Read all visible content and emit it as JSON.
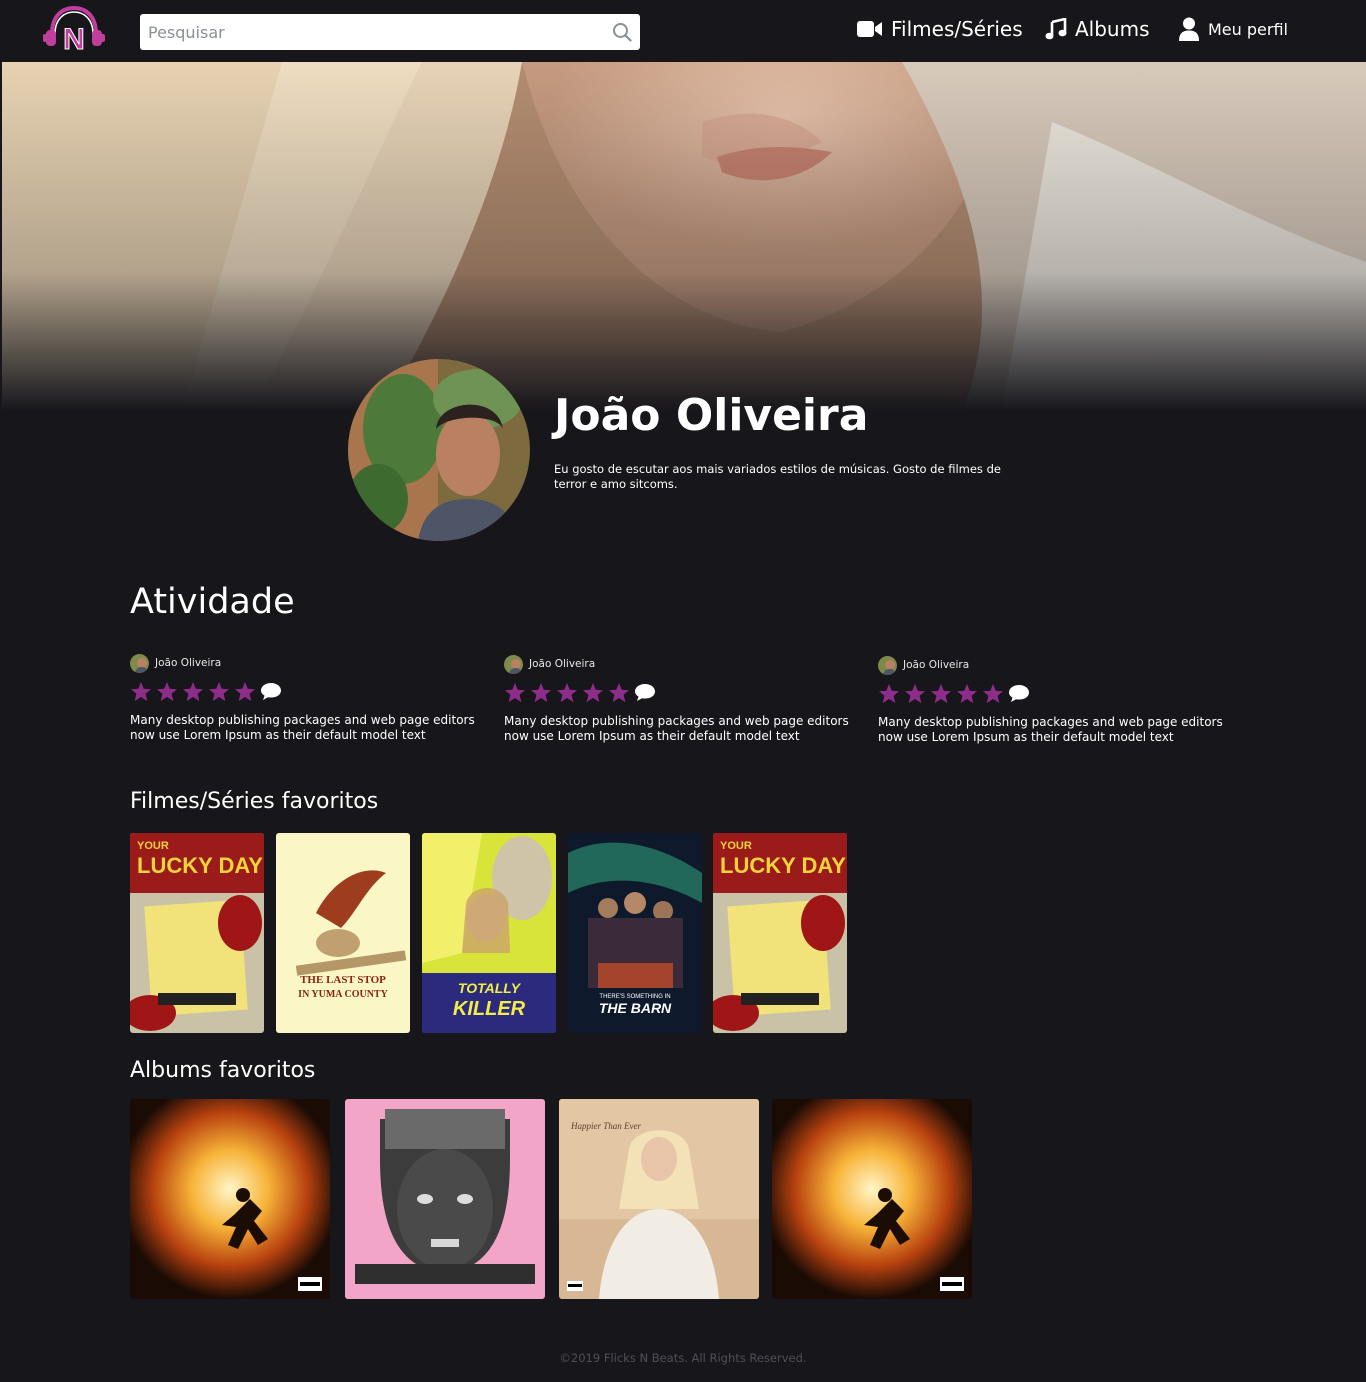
{
  "header": {
    "search_placeholder": "Pesquisar",
    "nav": {
      "films": "Filmes/Séries",
      "albums": "Albums",
      "profile": "Meu perfil"
    },
    "logo_letter": "N"
  },
  "profile": {
    "name": "João Oliveira",
    "bio": "Eu gosto de escutar aos mais variados estilos de músicas. Gosto de filmes de terror e amo sitcoms."
  },
  "activity": {
    "title": "Atividade",
    "items": [
      {
        "user": "João Oliveira",
        "stars": 5,
        "text": "Many desktop publishing packages and web page editors now use Lorem Ipsum as their default model text"
      },
      {
        "user": "João Oliveira",
        "stars": 5,
        "text": "Many desktop publishing packages and web page editors now use Lorem Ipsum as their default model text"
      },
      {
        "user": "João Oliveira",
        "stars": 5,
        "text": "Many desktop publishing packages and web page editors now use Lorem Ipsum as their default model text"
      }
    ]
  },
  "favorites_films": {
    "title": "Filmes/Séries favoritos",
    "items": [
      {
        "poster_text_1": "YOUR",
        "poster_text_2": "LUCKY DAY"
      },
      {
        "poster_text_1": "THE LAST STOP",
        "poster_text_2": "IN YUMA COUNTY"
      },
      {
        "poster_text_1": "TOTALLY",
        "poster_text_2": "KILLER"
      },
      {
        "poster_text_1": "THERE'S SOMETHING IN",
        "poster_text_2": "THE BARN"
      },
      {
        "poster_text_1": "YOUR",
        "poster_text_2": "LUCKY DAY"
      }
    ]
  },
  "favorites_albums": {
    "title": "Albums favoritos",
    "items": [
      {
        "cover_text": ""
      },
      {
        "cover_text": ""
      },
      {
        "cover_text": "Happier Than Ever"
      },
      {
        "cover_text": ""
      }
    ]
  },
  "footer": {
    "text": "©2019 Flicks N Beats. All Rights Reserved."
  },
  "colors": {
    "background": "#16161b",
    "accent_purple": "#8e2c8a",
    "logo_pink": "#c23e9c"
  }
}
